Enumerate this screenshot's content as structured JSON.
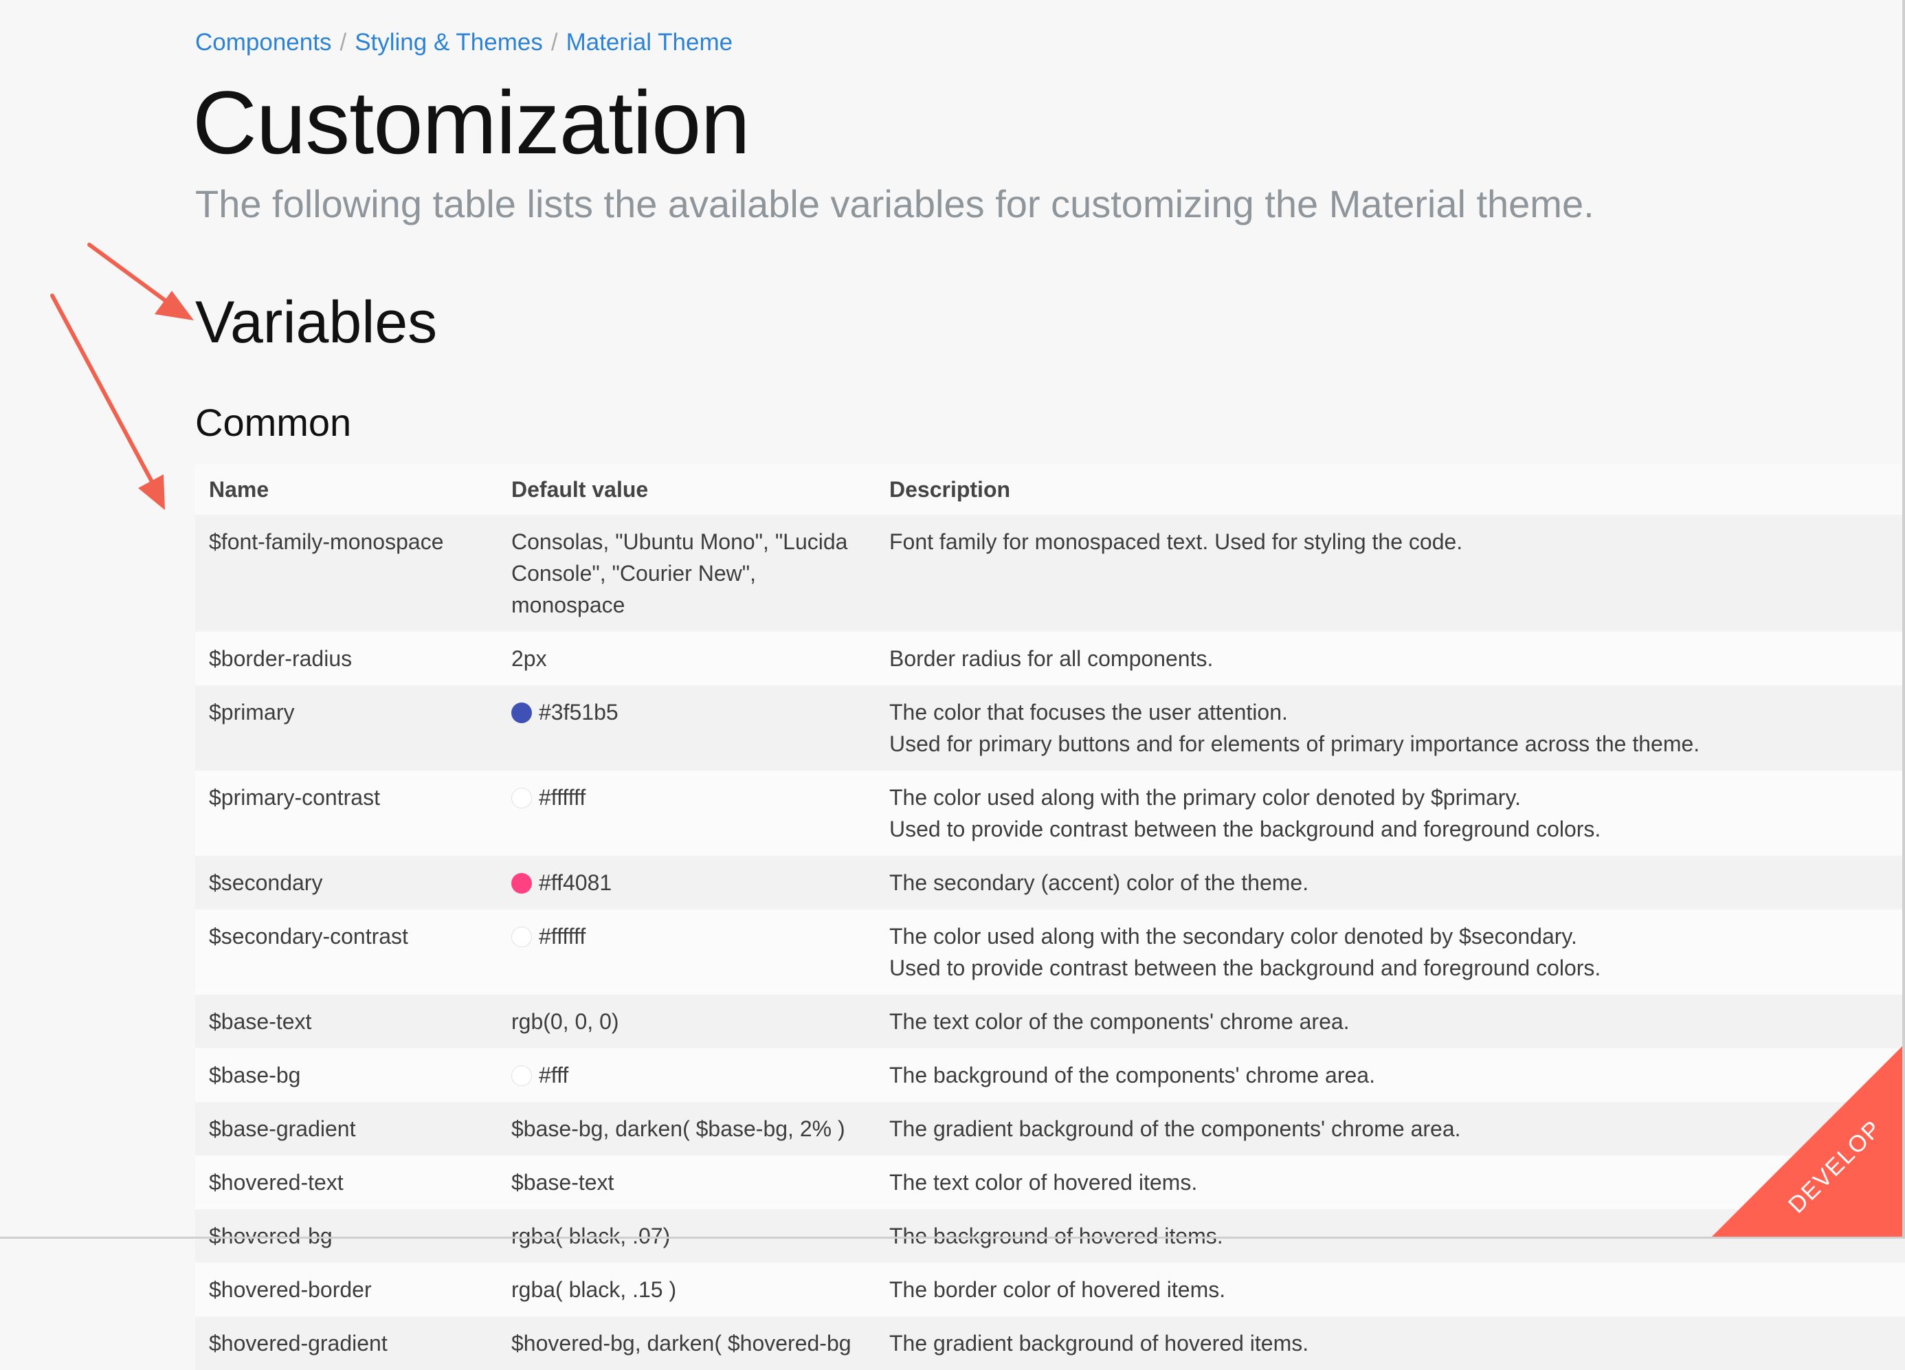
{
  "breadcrumb": {
    "items": [
      "Components",
      "Styling & Themes",
      "Material Theme"
    ],
    "separator": "/"
  },
  "page_title": "Customization",
  "lead": "The following table lists the available variables for customizing the Material theme.",
  "section_title": "Variables",
  "subsection_title": "Common",
  "table": {
    "headers": [
      "Name",
      "Default value",
      "Description"
    ],
    "rows": [
      {
        "name": "$font-family-monospace",
        "default": "Consolas, \"Ubuntu Mono\", \"Lucida Console\", \"Courier New\", monospace",
        "swatch": "",
        "desc1": "Font family for monospaced text. Used for styling the code.",
        "desc2": ""
      },
      {
        "name": "$border-radius",
        "default": "2px",
        "swatch": "",
        "desc1": "Border radius for all components.",
        "desc2": ""
      },
      {
        "name": "$primary",
        "default": "#3f51b5",
        "swatch": "#3f51b5",
        "desc1": "The color that focuses the user attention.",
        "desc2": "Used for primary buttons and for elements of primary importance across the theme."
      },
      {
        "name": "$primary-contrast",
        "default": "#ffffff",
        "swatch": "#ffffff",
        "desc1": "The color used along with the primary color denoted by $primary.",
        "desc2": "Used to provide contrast between the background and foreground colors."
      },
      {
        "name": "$secondary",
        "default": "#ff4081",
        "swatch": "#ff4081",
        "desc1": "The secondary (accent) color of the theme.",
        "desc2": ""
      },
      {
        "name": "$secondary-contrast",
        "default": "#ffffff",
        "swatch": "#ffffff",
        "desc1": "The color used along with the secondary color denoted by $secondary.",
        "desc2": "Used to provide contrast between the background and foreground colors."
      },
      {
        "name": "$base-text",
        "default": "rgb(0, 0, 0)",
        "swatch": "",
        "desc1": "The text color of the components' chrome area.",
        "desc2": ""
      },
      {
        "name": "$base-bg",
        "default": "#fff",
        "swatch": "#ffffff",
        "desc1": "The background of the components' chrome area.",
        "desc2": ""
      },
      {
        "name": "$base-gradient",
        "default": "$base-bg, darken( $base-bg, 2% )",
        "swatch": "",
        "desc1": "The gradient background of the components' chrome area.",
        "desc2": ""
      },
      {
        "name": "$hovered-text",
        "default": "$base-text",
        "swatch": "",
        "desc1": "The text color of hovered items.",
        "desc2": ""
      },
      {
        "name": "$hovered-bg",
        "default": "rgba( black, .07)",
        "swatch": "",
        "desc1": "The background of hovered items.",
        "desc2": ""
      },
      {
        "name": "$hovered-border",
        "default": "rgba( black, .15 )",
        "swatch": "",
        "desc1": "The border color of hovered items.",
        "desc2": ""
      },
      {
        "name": "$hovered-gradient",
        "default": "$hovered-bg, darken( $hovered-bg",
        "swatch": "",
        "desc1": "The gradient background of hovered items.",
        "desc2": ""
      }
    ]
  },
  "ribbon": {
    "label": "DEVELOP",
    "color": "#ff6150"
  },
  "annotation": {
    "arrow_color": "#f0614f"
  },
  "colors": {
    "link": "#2c83d6",
    "title": "#111111",
    "lead": "#8e969c",
    "body_text": "#3d3d3d"
  }
}
